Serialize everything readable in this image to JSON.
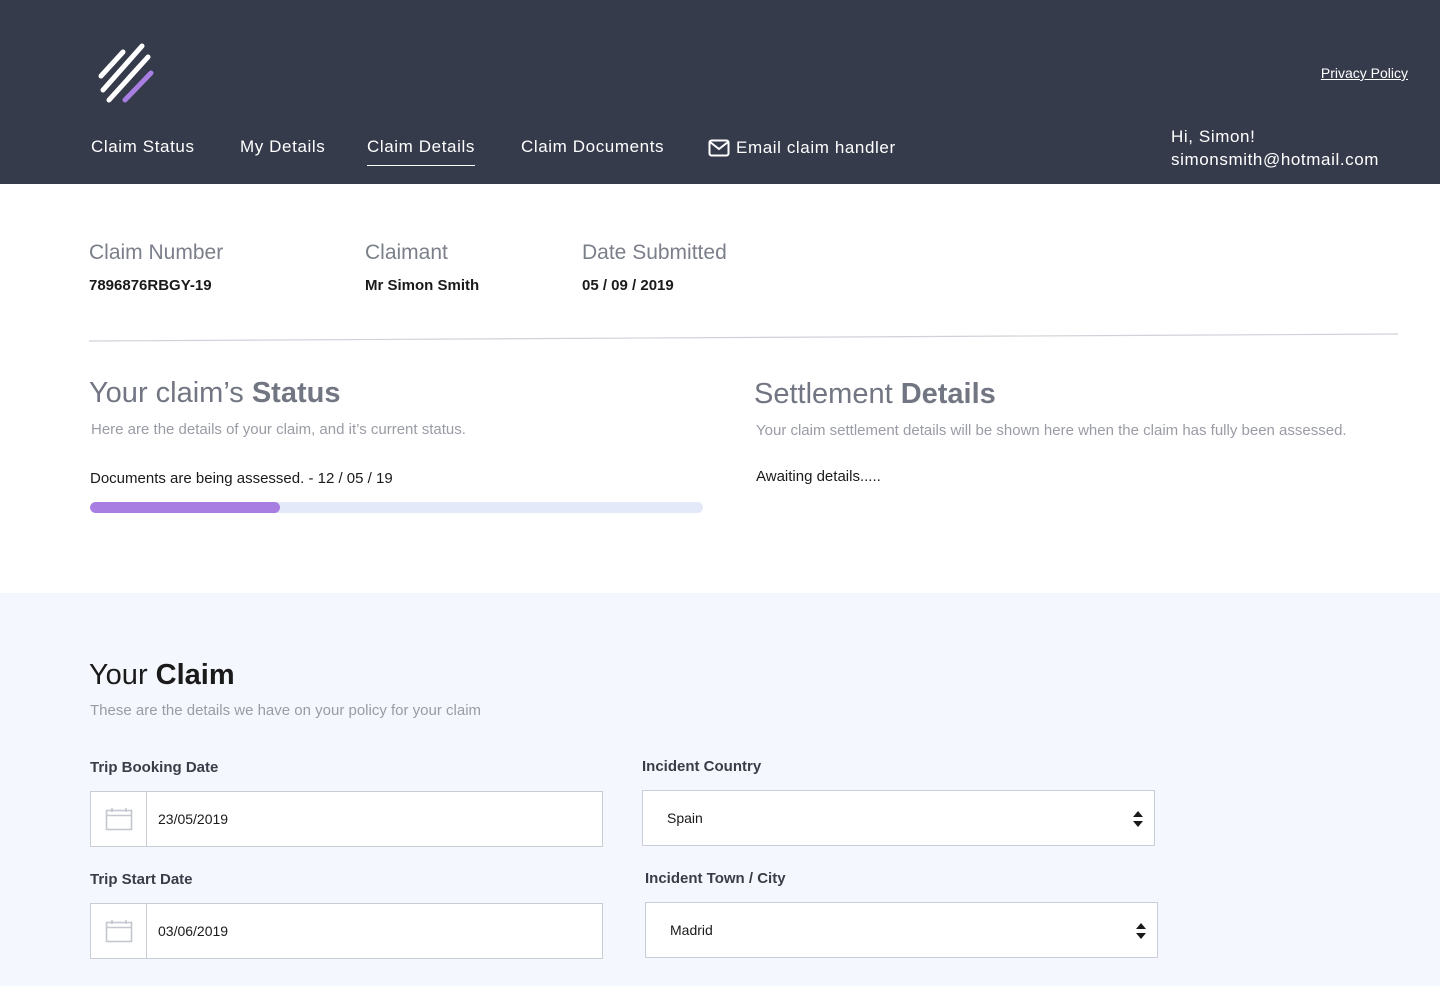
{
  "header": {
    "privacy_link": "Privacy Policy",
    "nav": {
      "claim_status": "Claim Status",
      "my_details": "My Details",
      "claim_details": "Claim Details",
      "claim_documents": "Claim Documents",
      "email_handler": "Email claim handler"
    },
    "greeting": "Hi, Simon!",
    "email": "simonsmith@hotmail.com"
  },
  "summary": {
    "claim_number_label": "Claim Number",
    "claim_number": "7896876RBGY-19",
    "claimant_label": "Claimant",
    "claimant": "Mr Simon Smith",
    "date_submitted_label": "Date Submitted",
    "date_submitted": "05 / 09 / 2019"
  },
  "status": {
    "title_light": "Your claim’s ",
    "title_bold": "Status",
    "subtitle": "Here are the details of your claim, and it’s current status.",
    "message": "Documents are being assessed. - 12 / 05 / 19",
    "progress": 0.31
  },
  "settlement": {
    "title_light": "Settlement ",
    "title_bold": "Details",
    "subtitle": "Your claim settlement details will be shown here when the claim has fully been assessed.",
    "message": "Awaiting details....."
  },
  "claim": {
    "title_light": "Your ",
    "title_bold": "Claim",
    "subtitle": "These are the details we have on your policy for your claim",
    "trip_booking_date_label": "Trip Booking Date",
    "trip_booking_date": "23/05/2019",
    "trip_start_date_label": "Trip Start Date",
    "trip_start_date": "03/06/2019",
    "incident_country_label": "Incident Country",
    "incident_country": "Spain",
    "incident_city_label": "Incident Town / City",
    "incident_city": "Madrid"
  },
  "colors": {
    "header_bg": "#363b4c",
    "accent": "#a97ee3",
    "section_bg": "#f4f7fd"
  },
  "icons": {
    "logo": "stripes-logo-icon",
    "email": "envelope-icon",
    "calendar": "calendar-icon",
    "select": "sort-arrows-icon"
  }
}
